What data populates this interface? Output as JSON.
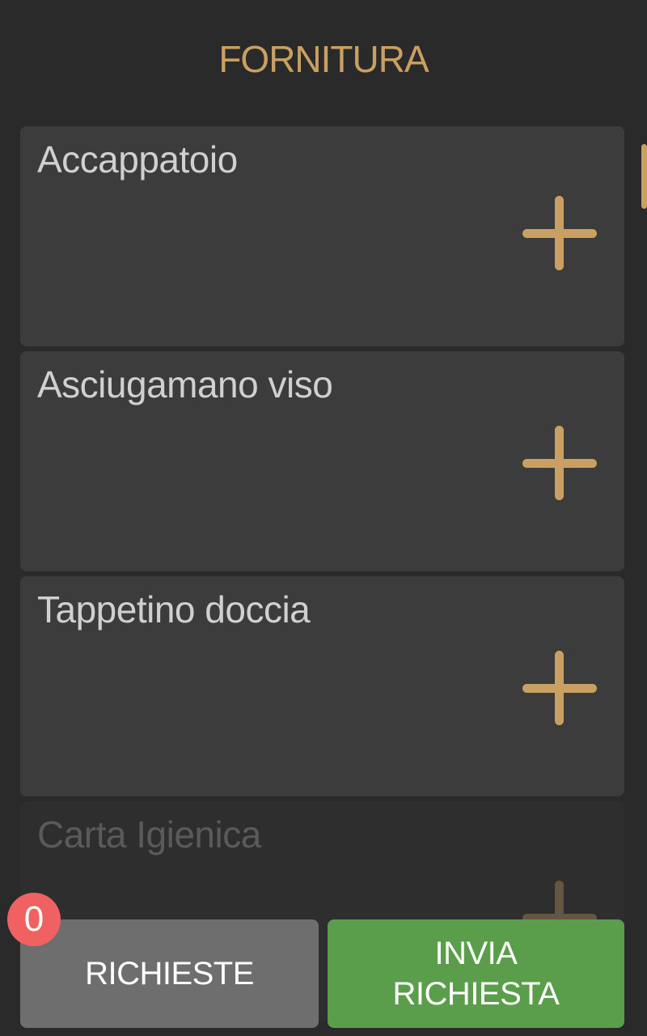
{
  "header": {
    "title": "FORNITURA"
  },
  "colors": {
    "accent": "#c9a062",
    "send_button": "#5a9e4b",
    "requests_button": "#6e6e6e",
    "badge": "#f06262"
  },
  "items": [
    {
      "label": "Accappatoio",
      "icon": "plus-icon"
    },
    {
      "label": "Asciugamano viso",
      "icon": "plus-icon"
    },
    {
      "label": "Tappetino doccia",
      "icon": "plus-icon"
    },
    {
      "label": "Carta Igienica",
      "icon": "plus-icon"
    }
  ],
  "footer": {
    "requests_label": "RICHIESTE",
    "requests_count": "0",
    "send_label_line1": "INVIA",
    "send_label_line2": "RICHIESTA"
  }
}
